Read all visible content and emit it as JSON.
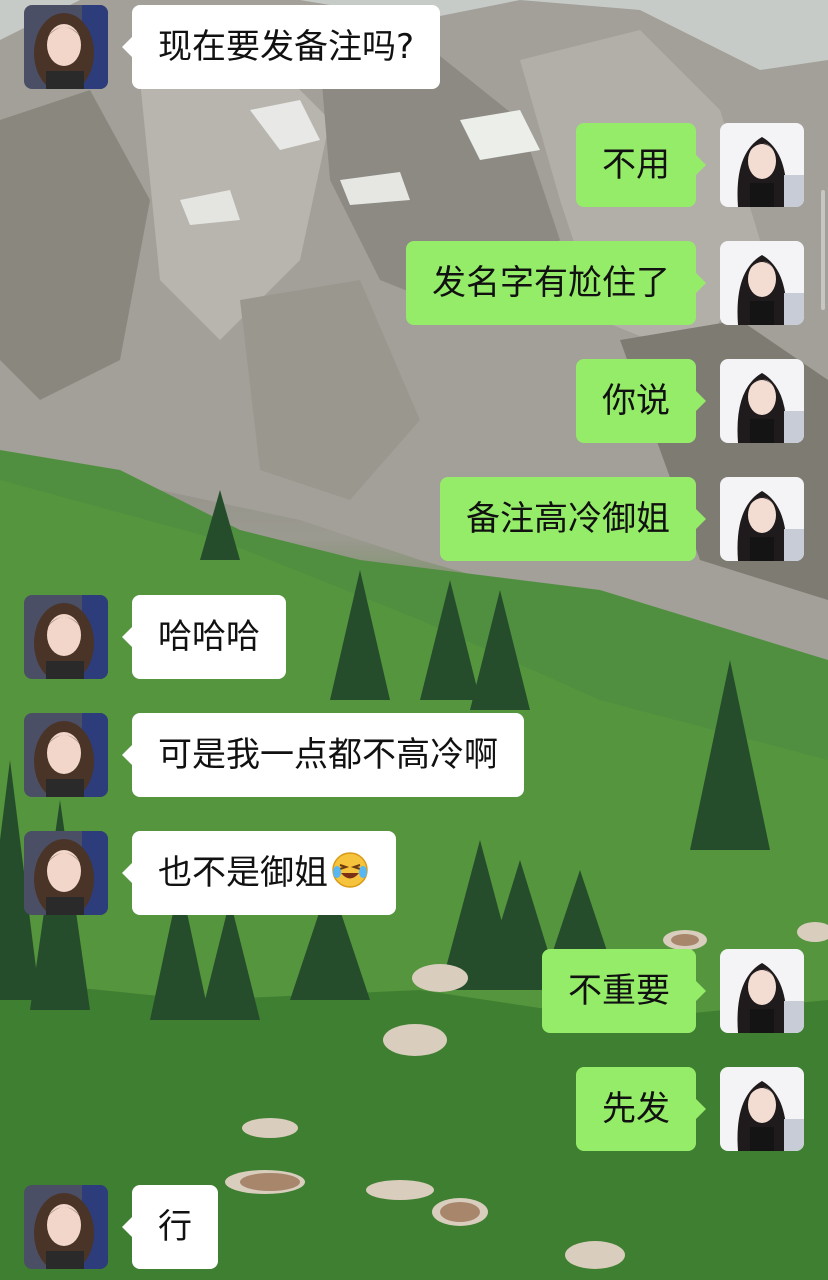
{
  "background": {
    "scene": "mountain-meadow-with-sheep",
    "colors": {
      "mountain": "#9d9a93",
      "grass": "#4b8a3c",
      "tree": "#254d2b"
    }
  },
  "colors": {
    "incoming_bubble": "#ffffff",
    "outgoing_bubble": "#95ec69",
    "text": "#111111"
  },
  "messages": [
    {
      "id": "m1",
      "side": "in",
      "text": "现在要发备注吗?",
      "emoji": ""
    },
    {
      "id": "m2",
      "side": "out",
      "text": "不用",
      "emoji": ""
    },
    {
      "id": "m3",
      "side": "out",
      "text": "发名字有尬住了",
      "emoji": ""
    },
    {
      "id": "m4",
      "side": "out",
      "text": "你说",
      "emoji": ""
    },
    {
      "id": "m5",
      "side": "out",
      "text": "备注高冷御姐",
      "emoji": ""
    },
    {
      "id": "m6",
      "side": "in",
      "text": "哈哈哈",
      "emoji": ""
    },
    {
      "id": "m7",
      "side": "in",
      "text": "可是我一点都不高冷啊",
      "emoji": ""
    },
    {
      "id": "m8",
      "side": "in",
      "text": "也不是御姐",
      "emoji": "laughing-tears-emoji"
    },
    {
      "id": "m9",
      "side": "out",
      "text": "不重要",
      "emoji": ""
    },
    {
      "id": "m10",
      "side": "out",
      "text": "先发",
      "emoji": ""
    },
    {
      "id": "m11",
      "side": "in",
      "text": "行",
      "emoji": ""
    }
  ],
  "avatars": {
    "incoming": "contact-avatar-woman-long-brown-hair",
    "outgoing": "self-avatar-woman-long-dark-hair"
  }
}
